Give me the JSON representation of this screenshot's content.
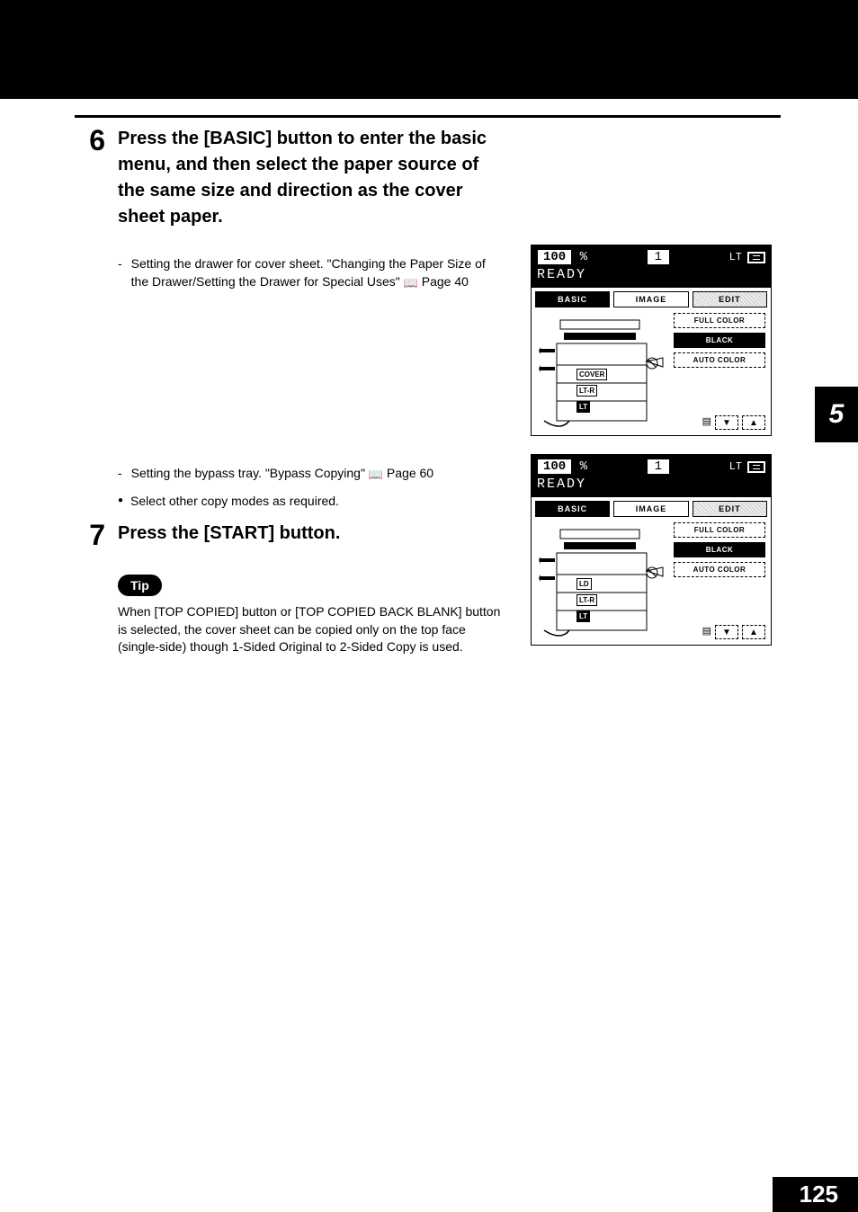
{
  "page": {
    "number": "125",
    "sectionTab": "5"
  },
  "step6": {
    "number": "6",
    "title": "Press the [BASIC] button to enter the basic menu, and then select the paper source of the same size and direction as the cover sheet paper.",
    "note1_prefix": "Setting the drawer for cover sheet. \"Changing the Paper Size of the Drawer/Setting the Drawer for Special Uses\"",
    "note1_page": "Page 40",
    "note2_prefix": "Setting the bypass tray. \"Bypass Copying\"",
    "note2_page": "Page 60",
    "bullet": "Select other copy modes as required."
  },
  "step7": {
    "number": "7",
    "title": "Press the [START] button.",
    "tipLabel": "Tip",
    "tipText": "When [TOP COPIED] button or [TOP COPIED BACK BLANK] button is selected, the cover sheet can be copied only on the top face (single-side) though 1-Sided Original to 2-Sided Copy is used."
  },
  "panelA": {
    "ratio": "100",
    "percent": "%",
    "qty": "1",
    "size": "LT",
    "ready": "READY",
    "tabs": {
      "basic": "BASIC",
      "image": "IMAGE",
      "edit": "EDIT"
    },
    "drawer1": "COVER",
    "drawer2": "LT-R",
    "drawer3": "LT",
    "opts": {
      "full": "FULL COLOR",
      "black": "BLACK",
      "auto": "AUTO COLOR"
    }
  },
  "panelB": {
    "ratio": "100",
    "percent": "%",
    "qty": "1",
    "size": "LT",
    "ready": "READY",
    "tabs": {
      "basic": "BASIC",
      "image": "IMAGE",
      "edit": "EDIT"
    },
    "drawer1": "LD",
    "drawer2": "LT-R",
    "drawer3": "LT",
    "opts": {
      "full": "FULL COLOR",
      "black": "BLACK",
      "auto": "AUTO COLOR"
    }
  }
}
